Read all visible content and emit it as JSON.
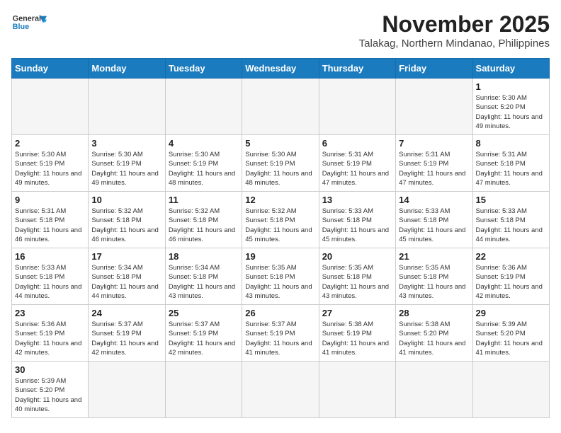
{
  "header": {
    "logo_general": "General",
    "logo_blue": "Blue",
    "month_title": "November 2025",
    "location": "Talakag, Northern Mindanao, Philippines"
  },
  "days_of_week": [
    "Sunday",
    "Monday",
    "Tuesday",
    "Wednesday",
    "Thursday",
    "Friday",
    "Saturday"
  ],
  "weeks": [
    [
      {
        "day": "",
        "info": ""
      },
      {
        "day": "",
        "info": ""
      },
      {
        "day": "",
        "info": ""
      },
      {
        "day": "",
        "info": ""
      },
      {
        "day": "",
        "info": ""
      },
      {
        "day": "",
        "info": ""
      },
      {
        "day": "1",
        "info": "Sunrise: 5:30 AM\nSunset: 5:20 PM\nDaylight: 11 hours\nand 49 minutes."
      }
    ],
    [
      {
        "day": "2",
        "info": "Sunrise: 5:30 AM\nSunset: 5:19 PM\nDaylight: 11 hours\nand 49 minutes."
      },
      {
        "day": "3",
        "info": "Sunrise: 5:30 AM\nSunset: 5:19 PM\nDaylight: 11 hours\nand 49 minutes."
      },
      {
        "day": "4",
        "info": "Sunrise: 5:30 AM\nSunset: 5:19 PM\nDaylight: 11 hours\nand 48 minutes."
      },
      {
        "day": "5",
        "info": "Sunrise: 5:30 AM\nSunset: 5:19 PM\nDaylight: 11 hours\nand 48 minutes."
      },
      {
        "day": "6",
        "info": "Sunrise: 5:31 AM\nSunset: 5:19 PM\nDaylight: 11 hours\nand 47 minutes."
      },
      {
        "day": "7",
        "info": "Sunrise: 5:31 AM\nSunset: 5:19 PM\nDaylight: 11 hours\nand 47 minutes."
      },
      {
        "day": "8",
        "info": "Sunrise: 5:31 AM\nSunset: 5:18 PM\nDaylight: 11 hours\nand 47 minutes."
      }
    ],
    [
      {
        "day": "9",
        "info": "Sunrise: 5:31 AM\nSunset: 5:18 PM\nDaylight: 11 hours\nand 46 minutes."
      },
      {
        "day": "10",
        "info": "Sunrise: 5:32 AM\nSunset: 5:18 PM\nDaylight: 11 hours\nand 46 minutes."
      },
      {
        "day": "11",
        "info": "Sunrise: 5:32 AM\nSunset: 5:18 PM\nDaylight: 11 hours\nand 46 minutes."
      },
      {
        "day": "12",
        "info": "Sunrise: 5:32 AM\nSunset: 5:18 PM\nDaylight: 11 hours\nand 45 minutes."
      },
      {
        "day": "13",
        "info": "Sunrise: 5:33 AM\nSunset: 5:18 PM\nDaylight: 11 hours\nand 45 minutes."
      },
      {
        "day": "14",
        "info": "Sunrise: 5:33 AM\nSunset: 5:18 PM\nDaylight: 11 hours\nand 45 minutes."
      },
      {
        "day": "15",
        "info": "Sunrise: 5:33 AM\nSunset: 5:18 PM\nDaylight: 11 hours\nand 44 minutes."
      }
    ],
    [
      {
        "day": "16",
        "info": "Sunrise: 5:33 AM\nSunset: 5:18 PM\nDaylight: 11 hours\nand 44 minutes."
      },
      {
        "day": "17",
        "info": "Sunrise: 5:34 AM\nSunset: 5:18 PM\nDaylight: 11 hours\nand 44 minutes."
      },
      {
        "day": "18",
        "info": "Sunrise: 5:34 AM\nSunset: 5:18 PM\nDaylight: 11 hours\nand 43 minutes."
      },
      {
        "day": "19",
        "info": "Sunrise: 5:35 AM\nSunset: 5:18 PM\nDaylight: 11 hours\nand 43 minutes."
      },
      {
        "day": "20",
        "info": "Sunrise: 5:35 AM\nSunset: 5:18 PM\nDaylight: 11 hours\nand 43 minutes."
      },
      {
        "day": "21",
        "info": "Sunrise: 5:35 AM\nSunset: 5:18 PM\nDaylight: 11 hours\nand 43 minutes."
      },
      {
        "day": "22",
        "info": "Sunrise: 5:36 AM\nSunset: 5:19 PM\nDaylight: 11 hours\nand 42 minutes."
      }
    ],
    [
      {
        "day": "23",
        "info": "Sunrise: 5:36 AM\nSunset: 5:19 PM\nDaylight: 11 hours\nand 42 minutes."
      },
      {
        "day": "24",
        "info": "Sunrise: 5:37 AM\nSunset: 5:19 PM\nDaylight: 11 hours\nand 42 minutes."
      },
      {
        "day": "25",
        "info": "Sunrise: 5:37 AM\nSunset: 5:19 PM\nDaylight: 11 hours\nand 42 minutes."
      },
      {
        "day": "26",
        "info": "Sunrise: 5:37 AM\nSunset: 5:19 PM\nDaylight: 11 hours\nand 41 minutes."
      },
      {
        "day": "27",
        "info": "Sunrise: 5:38 AM\nSunset: 5:19 PM\nDaylight: 11 hours\nand 41 minutes."
      },
      {
        "day": "28",
        "info": "Sunrise: 5:38 AM\nSunset: 5:20 PM\nDaylight: 11 hours\nand 41 minutes."
      },
      {
        "day": "29",
        "info": "Sunrise: 5:39 AM\nSunset: 5:20 PM\nDaylight: 11 hours\nand 41 minutes."
      }
    ],
    [
      {
        "day": "30",
        "info": "Sunrise: 5:39 AM\nSunset: 5:20 PM\nDaylight: 11 hours\nand 40 minutes."
      },
      {
        "day": "",
        "info": ""
      },
      {
        "day": "",
        "info": ""
      },
      {
        "day": "",
        "info": ""
      },
      {
        "day": "",
        "info": ""
      },
      {
        "day": "",
        "info": ""
      },
      {
        "day": "",
        "info": ""
      }
    ]
  ]
}
